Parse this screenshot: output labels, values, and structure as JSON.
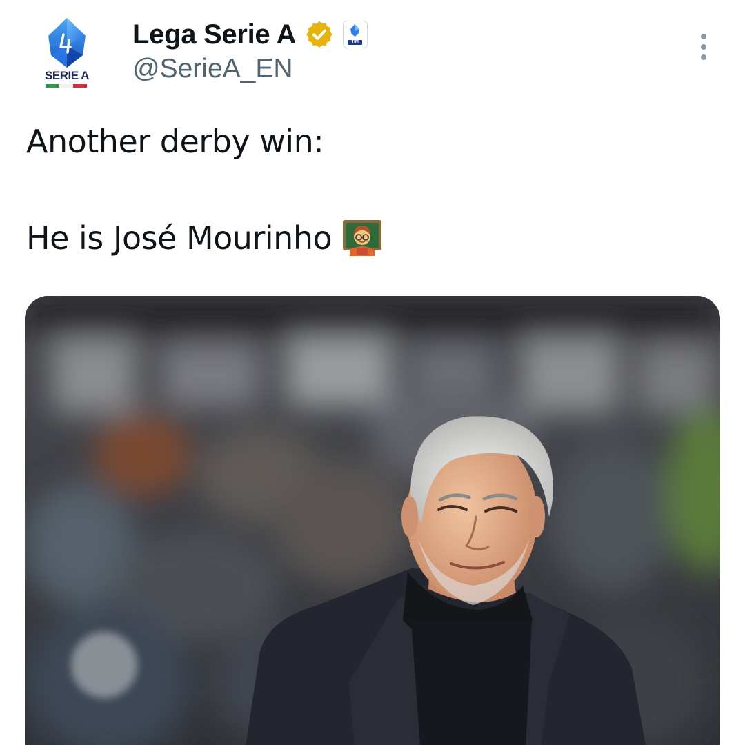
{
  "account": {
    "avatar_label": "SERIE A",
    "display_name": "Lega Serie A",
    "handle": "@SerieA_EN",
    "verified_badge_color": "#e9b40a",
    "affiliate_badge_label": "TIM",
    "brand_color": "#1e2a54"
  },
  "tweet": {
    "line1": "Another derby win:",
    "line2": "He is José Mourinho",
    "emoji": "teacher-emoji"
  },
  "icons": {
    "more": "more-vertical-icon",
    "verified": "verified-check-icon"
  },
  "media": {
    "description_icon": "photo"
  }
}
